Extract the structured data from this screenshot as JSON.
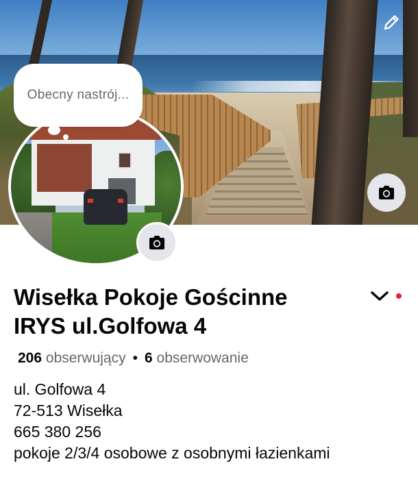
{
  "cover": {
    "edit_icon": "pencil-icon",
    "camera_icon": "camera-icon"
  },
  "profile": {
    "mood_placeholder": "Obecny nastrój...",
    "camera_icon": "camera-icon"
  },
  "page": {
    "name": "Wisełka Pokoje Gościnne IRYS ul.Golfowa 4",
    "dropdown_icon": "chevron-down-icon",
    "notification_color": "#e41e3f"
  },
  "stats": {
    "followers_count": "206",
    "followers_label": "obserwujący",
    "separator": "•",
    "following_count": "6",
    "following_label": "obserwowanie"
  },
  "bio": {
    "lines": [
      "ul. Golfowa 4",
      "72-513 Wisełka",
      "665 380 256",
      "pokoje 2/3/4 osobowe z osobnymi łazienkami"
    ]
  }
}
